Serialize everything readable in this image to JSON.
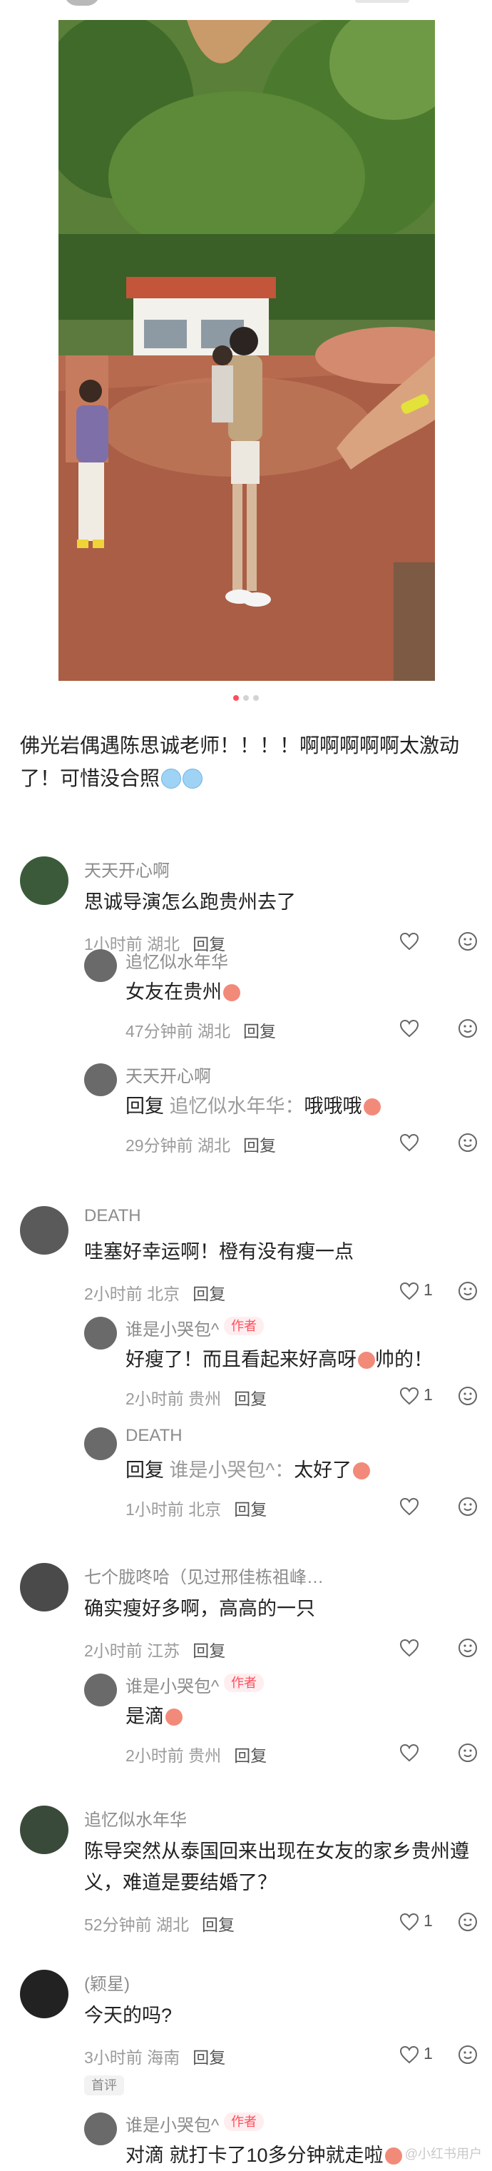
{
  "caption": {
    "text": "佛光岩偶遇陈思诚老师！！！！啊啊啊啊啊太激动了！可惜没合照",
    "emoji": [
      "crying-emoji",
      "crying-emoji"
    ]
  },
  "carousel": {
    "total": 3,
    "active": 1
  },
  "colors": {
    "accent": "#ff4d5a",
    "meta": "#9b9b9b"
  },
  "comments": [
    {
      "user": "天天开心啊",
      "text": "思诚导演怎么跑贵州去了",
      "time": "1小时前",
      "location": "湖北",
      "reply_label": "回复",
      "likes": "",
      "replies": [
        {
          "user": "追忆似水年华",
          "text": "女友在贵州",
          "time": "47分钟前",
          "location": "湖北",
          "reply_label": "回复",
          "likes": ""
        },
        {
          "user": "天天开心啊",
          "reply_prefix": "回复",
          "reply_to": "追忆似水年华：",
          "text": "哦哦哦",
          "time": "29分钟前",
          "location": "湖北",
          "reply_label": "回复",
          "likes": ""
        }
      ]
    },
    {
      "user": "DEATH",
      "text": "哇塞好幸运啊！橙有没有瘦一点",
      "time": "2小时前",
      "location": "北京",
      "reply_label": "回复",
      "likes": "1",
      "replies": [
        {
          "user": "谁是小哭包^",
          "author_tag": "作者",
          "text": "好瘦了！而且看起来好高呀",
          "text_after": "帅的！",
          "time": "2小时前",
          "location": "贵州",
          "reply_label": "回复",
          "likes": "1"
        },
        {
          "user": "DEATH",
          "reply_prefix": "回复",
          "reply_to": "谁是小哭包^：",
          "text": "太好了",
          "time": "1小时前",
          "location": "北京",
          "reply_label": "回复",
          "likes": ""
        }
      ]
    },
    {
      "user": "七个胧咚哈（见过邢佳栋祖峰…",
      "text": "确实瘦好多啊，高高的一只",
      "time": "2小时前",
      "location": "江苏",
      "reply_label": "回复",
      "likes": "",
      "replies": [
        {
          "user": "谁是小哭包^",
          "author_tag": "作者",
          "text": "是滴",
          "time": "2小时前",
          "location": "贵州",
          "reply_label": "回复",
          "likes": ""
        }
      ]
    },
    {
      "user": "追忆似水年华",
      "text": "陈导突然从泰国回来出现在女友的家乡贵州遵义，难道是要结婚了？",
      "time": "52分钟前",
      "location": "湖北",
      "reply_label": "回复",
      "likes": "1",
      "replies": []
    },
    {
      "user": "(颖星)",
      "text": "今天的吗?",
      "time": "3小时前",
      "location": "海南",
      "reply_label": "回复",
      "likes": "1",
      "badge": "首评",
      "replies": [
        {
          "user": "谁是小哭包^",
          "author_tag": "作者",
          "text": "对滴 就打卡了10多分钟就走啦",
          "time": "",
          "location": "",
          "reply_label": "",
          "likes": ""
        }
      ]
    }
  ],
  "watermark": "@小红书用户"
}
